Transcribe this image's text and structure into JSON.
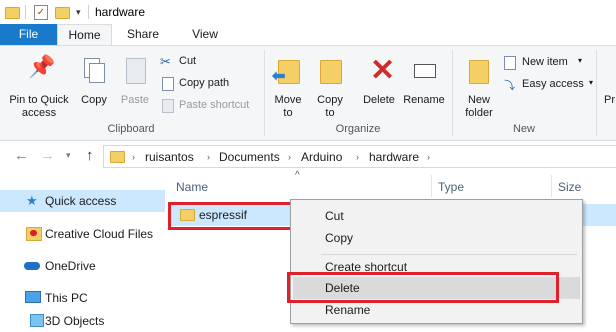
{
  "window": {
    "title": "hardware"
  },
  "tabs": {
    "file": "File",
    "home": "Home",
    "share": "Share",
    "view": "View"
  },
  "ribbon": {
    "clipboard": {
      "label": "Clipboard",
      "pin_line1": "Pin to Quick",
      "pin_line2": "access",
      "copy": "Copy",
      "paste": "Paste",
      "cut": "Cut",
      "copy_path": "Copy path",
      "paste_shortcut": "Paste shortcut"
    },
    "organize": {
      "label": "Organize",
      "move_to_line1": "Move",
      "move_to_line2": "to",
      "copy_to_line1": "Copy",
      "copy_to_line2": "to",
      "delete": "Delete",
      "rename": "Rename"
    },
    "new": {
      "label": "New",
      "new_folder_line1": "New",
      "new_folder_line2": "folder",
      "new_item": "New item",
      "easy_access": "Easy access"
    },
    "properties_cut": "Pr"
  },
  "address": {
    "crumbs": [
      "ruisantos",
      "Documents",
      "Arduino",
      "hardware"
    ]
  },
  "nav_pane": {
    "items": [
      {
        "label": "Quick access",
        "icon": "star-icon"
      },
      {
        "label": "Creative Cloud Files",
        "icon": "creative-cloud-icon"
      },
      {
        "label": "OneDrive",
        "icon": "onedrive-cloud-icon"
      },
      {
        "label": "This PC",
        "icon": "pc-icon"
      },
      {
        "label": "3D Objects",
        "icon": "3d-objects-icon"
      }
    ]
  },
  "file_list": {
    "columns": {
      "name": "Name",
      "type": "Type",
      "size": "Size"
    },
    "rows": [
      {
        "name": "espressif"
      }
    ]
  },
  "context_menu": {
    "items": [
      "Cut",
      "Copy",
      "Create shortcut",
      "Delete",
      "Rename"
    ]
  },
  "colors": {
    "accent": "#1979ca",
    "highlight_box": "#e0202a",
    "selection": "#cce8ff",
    "folder": "#f3cf66"
  }
}
